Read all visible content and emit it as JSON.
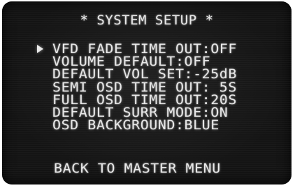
{
  "title": "* SYSTEM SETUP *",
  "menu": {
    "items": [
      {
        "label": "VFD FADE TIME OUT:OFF",
        "selected": true
      },
      {
        "label": "VOLUME DEFAULT:OFF",
        "selected": false
      },
      {
        "label": "DEFAULT VOL SET:-25dB",
        "selected": false
      },
      {
        "label": "SEMI OSD TIME OUT: 5S",
        "selected": false
      },
      {
        "label": "FULL OSD TIME OUT:20S",
        "selected": false
      },
      {
        "label": "DEFAULT SURR MODE:ON",
        "selected": false
      },
      {
        "label": "OSD BACKGROUND:BLUE",
        "selected": false
      }
    ]
  },
  "back_label": "BACK TO MASTER MENU",
  "cursor_icon": "right-triangle-pointer-icon",
  "colors": {
    "background": "#141414",
    "text": "#e8e8e8"
  }
}
